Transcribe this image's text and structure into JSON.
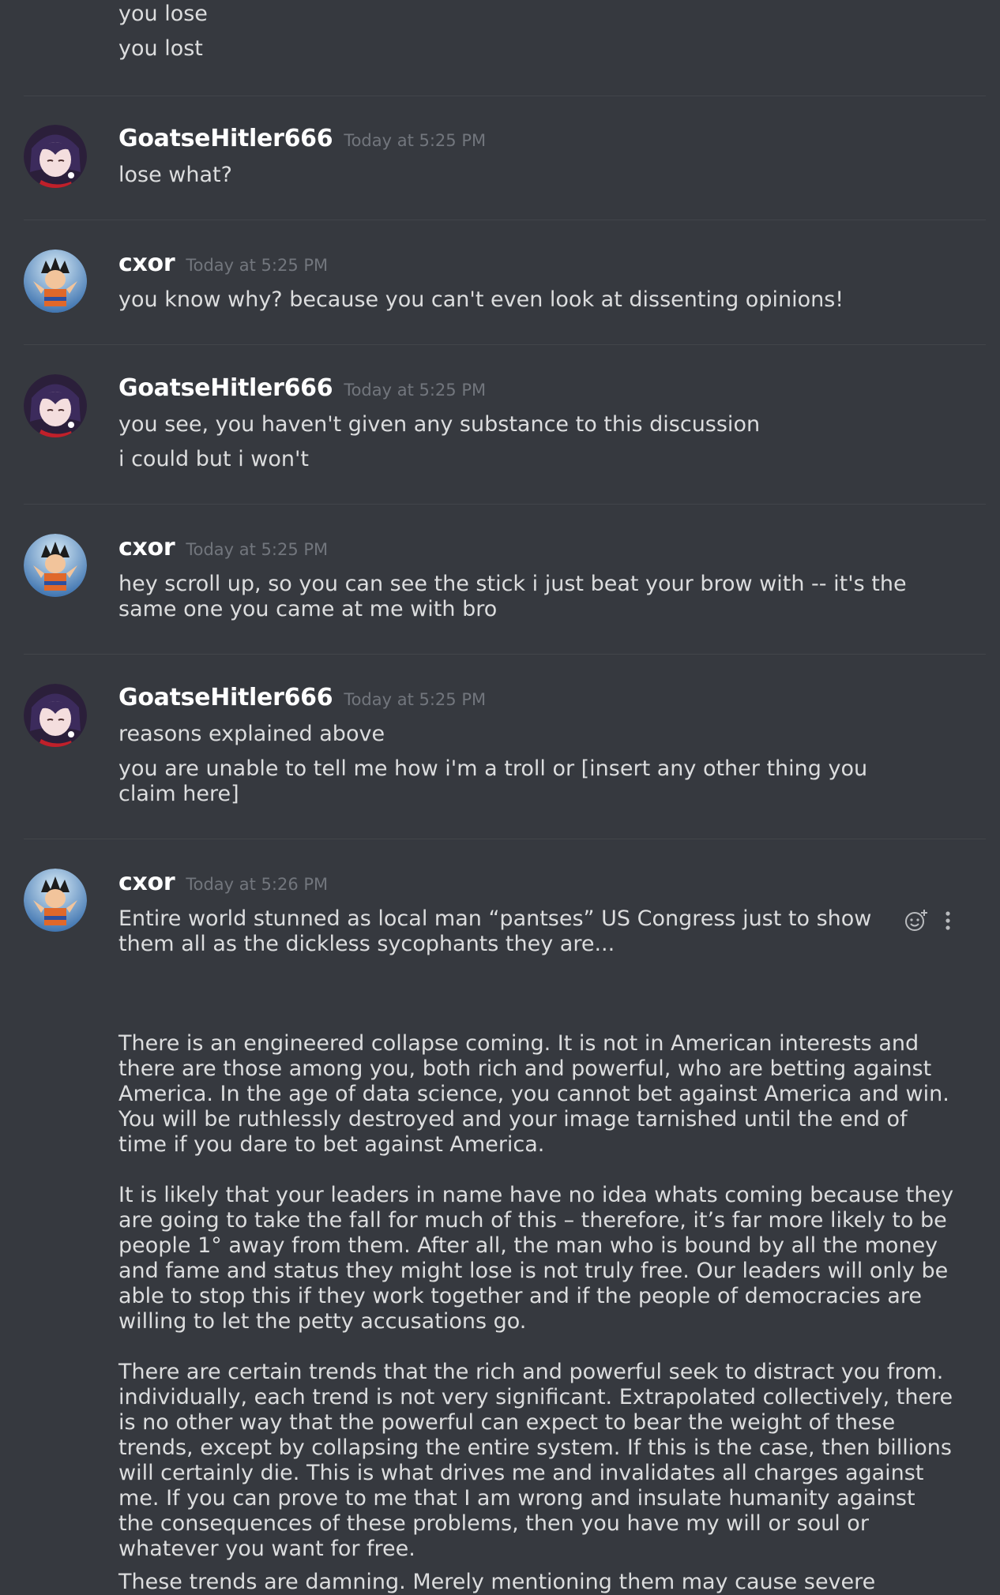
{
  "messages": {
    "top": {
      "lines": [
        "you lose",
        "you lost"
      ]
    },
    "m1": {
      "username": "GoatseHitler666",
      "timestamp": "Today at 5:25 PM",
      "lines": [
        "lose what?"
      ]
    },
    "m2": {
      "username": "cxor",
      "timestamp": "Today at 5:25 PM",
      "lines": [
        "you know why? because you can't even look at dissenting opinions!"
      ]
    },
    "m3": {
      "username": "GoatseHitler666",
      "timestamp": "Today at 5:25 PM",
      "lines": [
        "you see, you haven't given any substance to this discussion",
        "i could but i won't"
      ]
    },
    "m4": {
      "username": "cxor",
      "timestamp": "Today at 5:25 PM",
      "lines": [
        "hey scroll up, so you can see the stick i just beat your brow with -- it's the same one you came at me with bro"
      ]
    },
    "m5": {
      "username": "GoatseHitler666",
      "timestamp": "Today at 5:25 PM",
      "lines": [
        "reasons explained above",
        "you are unable to tell me how i'm a troll or [insert any other thing you claim here]"
      ]
    },
    "m6": {
      "username": "cxor",
      "timestamp": "Today at 5:26 PM",
      "lines": [
        "Entire world stunned as local man “pantses” US Congress just to show them all as the dickless sycophants they are..."
      ],
      "paragraphs": [
        "There is an engineered collapse coming. It is not in American interests and there are those among you, both rich and powerful, who are betting against America. In the age of data science, you cannot bet against America and win. You will be ruthlessly destroyed and your image tarnished until the end of time if you dare to bet against America.",
        "It is likely that your leaders in name have no idea whats coming because they are going to take the fall for much of this – therefore, it’s far more likely to be people 1° away from them. After all, the man who is bound by all the money and fame and status they might lose is not truly free. Our leaders will only be able to stop this if they work together and if the people of democracies are willing to let the petty accusations go.",
        "There are certain trends that the rich and powerful seek to distract you from. individually, each trend is not very significant. Extrapolated collectively, there is no other way that the powerful can expect to bear the weight of these trends, except by collapsing the entire system. If this is the case, then billions will certainly die. This is what drives me and invalidates all charges against me. If you can prove to me that I am wrong and insulate humanity against the consequences of these problems, then you have my will or soul or whatever you want for free.",
        "These trends are damning. Merely mentioning them may cause severe"
      ]
    }
  },
  "icons": {
    "avatar_goatse": "avatar-anime-girl",
    "avatar_cxor": "avatar-goku",
    "add_reaction": "add-reaction-icon",
    "more": "more-options-icon"
  },
  "colors": {
    "background": "#36393f",
    "username": "#ffffff",
    "timestamp": "#72767d",
    "text": "#dcddde",
    "divider": "#42454a"
  }
}
